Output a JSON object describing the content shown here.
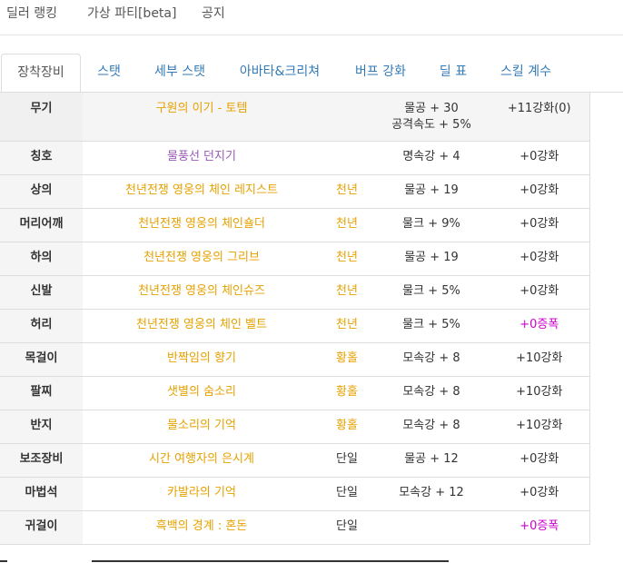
{
  "topnav": [
    "딜러 랭킹",
    "가상 파티[beta]",
    "공지"
  ],
  "tabs": [
    "장착장비",
    "스탯",
    "세부 스탯",
    "아바타&크리쳐",
    "버프 강화",
    "딜 표",
    "스킬 계수"
  ],
  "equipment": [
    {
      "slot": "무기",
      "name": "구원의 이기 - 토템",
      "grade": "",
      "stat": "물공 + 30",
      "stat2": "공격속도 + 5%",
      "enh": "+11강화(0)"
    },
    {
      "slot": "칭호",
      "name": "물풍선 던지기",
      "grade": "",
      "stat": "명속강 + 4",
      "stat2": "",
      "enh": "+0강화"
    },
    {
      "slot": "상의",
      "name": "천년전쟁 영웅의 체인 레지스트",
      "grade": "천년",
      "stat": "물공 + 19",
      "stat2": "",
      "enh": "+0강화"
    },
    {
      "slot": "머리어깨",
      "name": "천년전쟁 영웅의 체인숄더",
      "grade": "천년",
      "stat": "물크 + 9%",
      "stat2": "",
      "enh": "+0강화"
    },
    {
      "slot": "하의",
      "name": "천년전쟁 영웅의 그리브",
      "grade": "천년",
      "stat": "물공 + 19",
      "stat2": "",
      "enh": "+0강화"
    },
    {
      "slot": "신발",
      "name": "천년전쟁 영웅의 체인슈즈",
      "grade": "천년",
      "stat": "물크 + 5%",
      "stat2": "",
      "enh": "+0강화"
    },
    {
      "slot": "허리",
      "name": "천년전쟁 영웅의 체인 벨트",
      "grade": "천년",
      "stat": "물크 + 5%",
      "stat2": "",
      "enh": "+0증폭"
    },
    {
      "slot": "목걸이",
      "name": "반짝임의 향기",
      "grade": "황홀",
      "stat": "모속강 + 8",
      "stat2": "",
      "enh": "+10강화"
    },
    {
      "slot": "팔찌",
      "name": "샛별의 숨소리",
      "grade": "황홀",
      "stat": "모속강 + 8",
      "stat2": "",
      "enh": "+10강화"
    },
    {
      "slot": "반지",
      "name": "물소리의 기억",
      "grade": "황홀",
      "stat": "모속강 + 8",
      "stat2": "",
      "enh": "+10강화"
    },
    {
      "slot": "보조장비",
      "name": "시간 여행자의 은시계",
      "grade": "단일",
      "stat": "물공 + 12",
      "stat2": "",
      "enh": "+0강화"
    },
    {
      "slot": "마법석",
      "name": "카발라의 기억",
      "grade": "단일",
      "stat": "모속강 + 12",
      "stat2": "",
      "enh": "+0강화"
    },
    {
      "slot": "귀걸이",
      "name": "흑백의 경계 : 혼돈",
      "grade": "단일",
      "stat": "",
      "stat2": "",
      "enh": "+0증폭"
    }
  ]
}
